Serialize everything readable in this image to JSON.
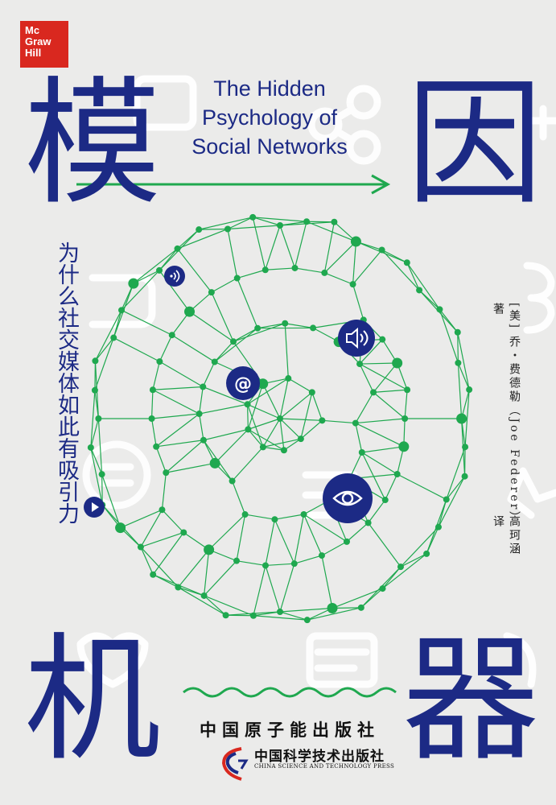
{
  "publisher_logo": {
    "line1": "Mc",
    "line2": "Graw",
    "line3": "Hill",
    "color": "#d9281f"
  },
  "english_title": {
    "line1": "The Hidden",
    "line2": "Psychology of",
    "line3": "Social Networks"
  },
  "chinese_title": {
    "char1": "模",
    "char2": "因",
    "char3": "机",
    "char4": "器"
  },
  "subtitle": "为什么社交媒体如此有吸引力",
  "author": {
    "name_line": "[美] 乔・费德勒（Joe Federer）著",
    "translator_line": "高珂涵　译"
  },
  "publisher": {
    "name": "中国原子能出版社",
    "press_cn": "中国科学技术出版社",
    "press_en": "CHINA SCIENCE AND TECHNOLOGY PRESS"
  },
  "colors": {
    "navy": "#1c2a85",
    "green": "#1fa84f",
    "background": "#ebebea",
    "ghost_icons": "#ffffff"
  },
  "icons": [
    "wifi-icon",
    "speaker-icon",
    "at-sign-icon",
    "eye-icon",
    "play-icon",
    "share-icon",
    "press-logo-icon"
  ]
}
